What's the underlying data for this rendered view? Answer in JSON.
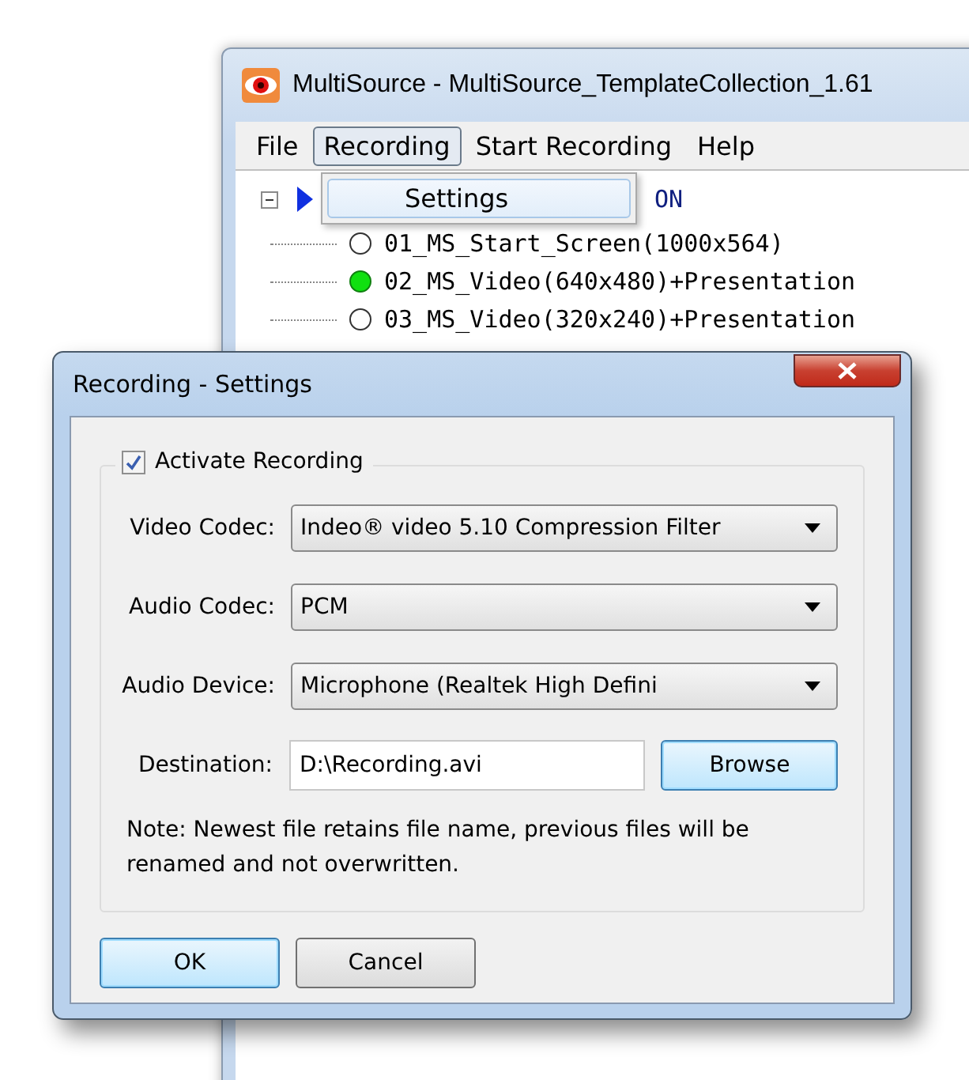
{
  "main_window": {
    "title": "MultiSource - MultiSource_TemplateCollection_1.61",
    "menu": [
      {
        "label": "File",
        "selected": false
      },
      {
        "label": "Recording",
        "selected": true
      },
      {
        "label": "Start Recording",
        "selected": false
      },
      {
        "label": "Help",
        "selected": false
      }
    ],
    "menu_dropdown": [
      {
        "label": "Settings",
        "selected": true
      }
    ],
    "tree": {
      "label": "ON",
      "expanded": true,
      "children": [
        {
          "label": "01_MS_Start_Screen(1000x564)",
          "active": false
        },
        {
          "label": "02_MS_Video(640x480)+Presentation",
          "active": true
        },
        {
          "label": "03_MS_Video(320x240)+Presentation",
          "active": false
        }
      ]
    }
  },
  "dialog": {
    "title": "Recording - Settings",
    "activate": {
      "label": "Activate Recording",
      "checked": true
    },
    "fields": [
      {
        "kind": "dropdown",
        "label": "Video Codec:",
        "value": "Indeo® video 5.10 Compression Filter"
      },
      {
        "kind": "dropdown",
        "label": "Audio Codec:",
        "value": "PCM"
      },
      {
        "kind": "dropdown",
        "label": "Audio Device:",
        "value": "Microphone (Realtek High Defini"
      },
      {
        "kind": "path",
        "label": "Destination:",
        "value": "D:\\Recording.avi",
        "button": "Browse"
      }
    ],
    "note": "Note: Newest file retains file name, previous files will be renamed and not overwritten.",
    "buttons": [
      {
        "label": "OK",
        "default": true
      },
      {
        "label": "Cancel",
        "default": false
      }
    ]
  }
}
